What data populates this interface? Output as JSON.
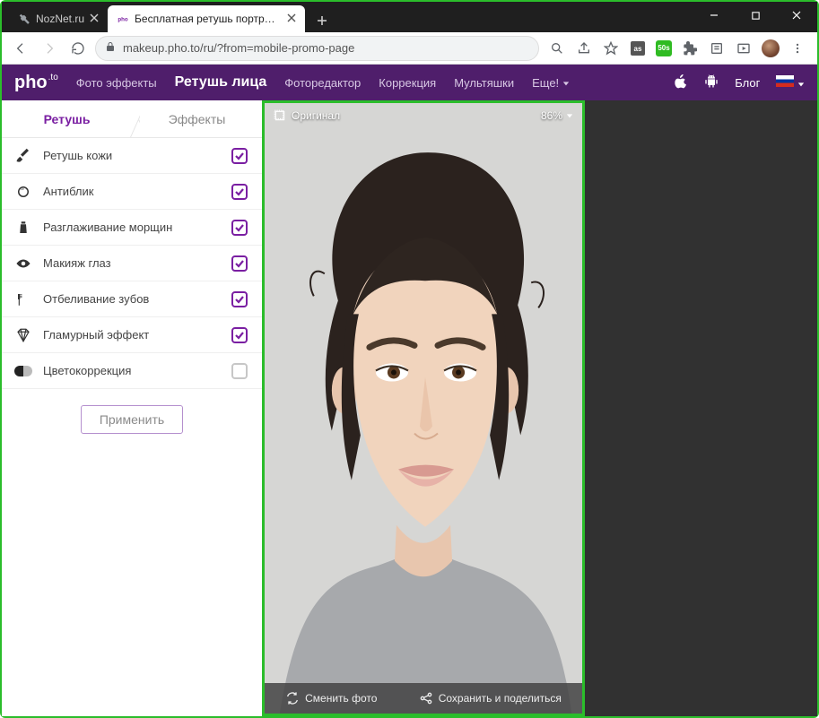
{
  "browser": {
    "tabs": [
      {
        "title": "NozNet.ru",
        "active": false
      },
      {
        "title": "Бесплатная ретушь портретных",
        "active": true
      }
    ],
    "url": "makeup.pho.to/ru/?from=mobile-promo-page",
    "ext_badge": "50s"
  },
  "site": {
    "logo": "pho",
    "logo_suffix": ".to",
    "nav": {
      "effects": "Фото эффекты",
      "retouch": "Ретушь лица",
      "editor": "Фоторедактор",
      "correction": "Коррекция",
      "cartoons": "Мультяшки",
      "more": "Еще!"
    },
    "blog": "Блог"
  },
  "sidebar": {
    "tabs": {
      "retouch": "Ретушь",
      "effects": "Эффекты"
    },
    "options": [
      {
        "id": "skin",
        "label": "Ретушь кожи",
        "checked": true
      },
      {
        "id": "glare",
        "label": "Антиблик",
        "checked": true
      },
      {
        "id": "wrinkle",
        "label": "Разглаживание морщин",
        "checked": true
      },
      {
        "id": "eyes",
        "label": "Макияж глаз",
        "checked": true
      },
      {
        "id": "teeth",
        "label": "Отбеливание зубов",
        "checked": true
      },
      {
        "id": "glam",
        "label": "Гламурный эффект",
        "checked": true
      },
      {
        "id": "color",
        "label": "Цветокоррекция",
        "checked": false
      }
    ],
    "apply": "Применить"
  },
  "canvas": {
    "original_label": "Оригинал",
    "zoom": "86%",
    "change_photo": "Сменить фото",
    "save_share": "Сохранить и поделиться"
  }
}
